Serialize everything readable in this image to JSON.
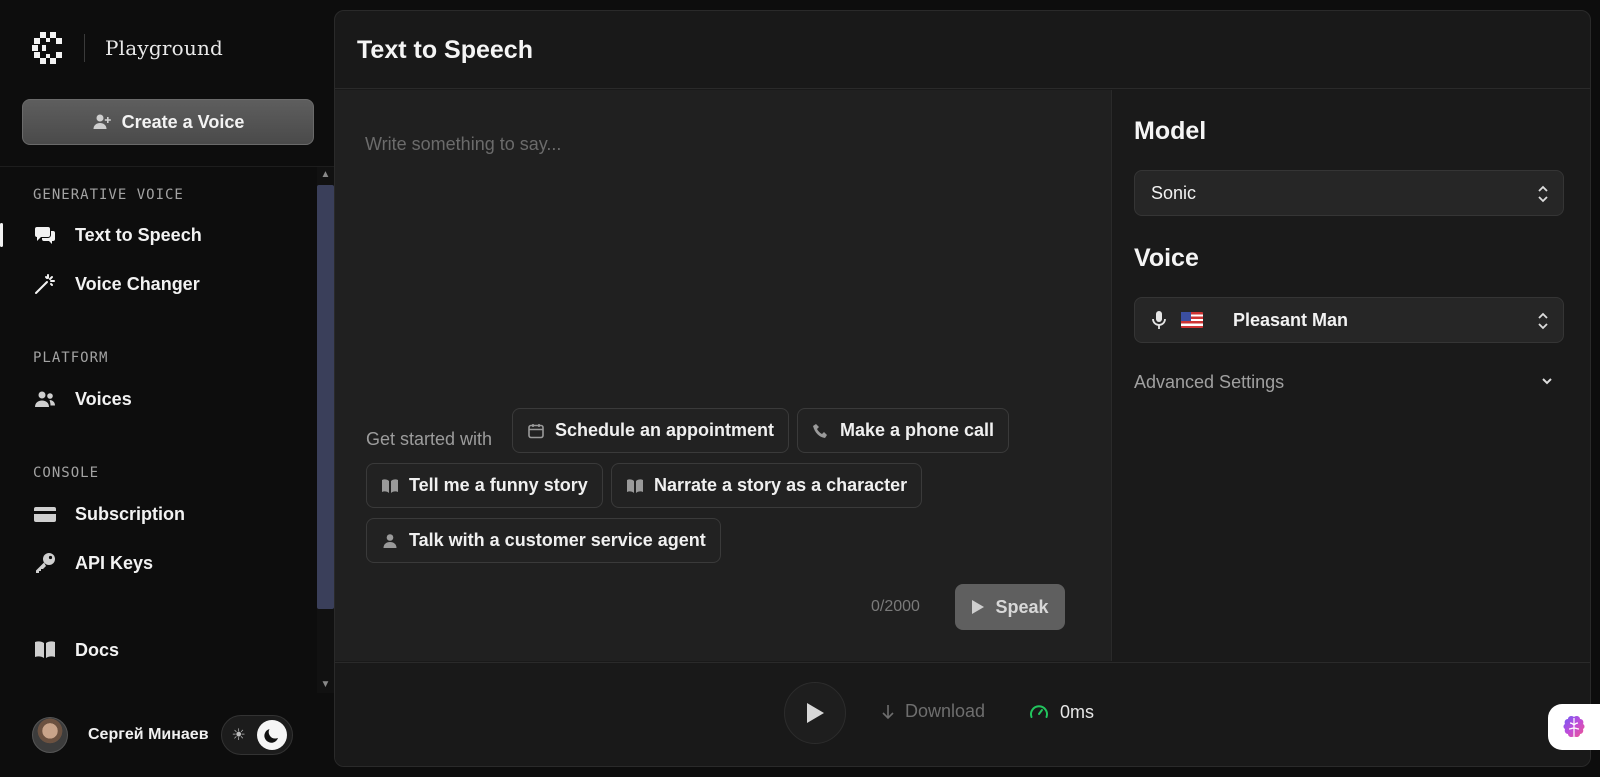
{
  "sidebar": {
    "brand_name": "Playground",
    "create_voice_label": "Create a Voice",
    "sections": [
      {
        "label": "GENERATIVE VOICE",
        "items": [
          {
            "label": "Text to Speech",
            "icon": "chat-bubbles-icon",
            "active": true
          },
          {
            "label": "Voice Changer",
            "icon": "magic-wand-icon"
          }
        ]
      },
      {
        "label": "PLATFORM",
        "items": [
          {
            "label": "Voices",
            "icon": "users-icon"
          }
        ]
      },
      {
        "label": "CONSOLE",
        "items": [
          {
            "label": "Subscription",
            "icon": "credit-card-icon"
          },
          {
            "label": "API Keys",
            "icon": "key-icon"
          }
        ]
      }
    ],
    "docs_label": "Docs",
    "user_name": "Сергей Минаев"
  },
  "main": {
    "title": "Text to Speech",
    "editor": {
      "placeholder": "Write something to say...",
      "get_started_label": "Get started with",
      "chips": [
        {
          "label": "Schedule an appointment",
          "icon": "calendar-icon"
        },
        {
          "label": "Make a phone call",
          "icon": "phone-icon"
        },
        {
          "label": "Tell me a funny story",
          "icon": "book-icon"
        },
        {
          "label": "Narrate a story as a character",
          "icon": "book-icon"
        },
        {
          "label": "Talk with a customer service agent",
          "icon": "person-icon"
        }
      ],
      "char_count": "0/2000",
      "speak_label": "Speak"
    },
    "settings": {
      "model_heading": "Model",
      "model_value": "Sonic",
      "voice_heading": "Voice",
      "voice_value": "Pleasant Man",
      "advanced_label": "Advanced Settings"
    },
    "player": {
      "download_label": "Download",
      "latency": "0ms"
    }
  },
  "colors": {
    "background": "#0d0d0d",
    "panel": "#191919",
    "editor": "#202020",
    "latency_accent": "#22c55e"
  }
}
